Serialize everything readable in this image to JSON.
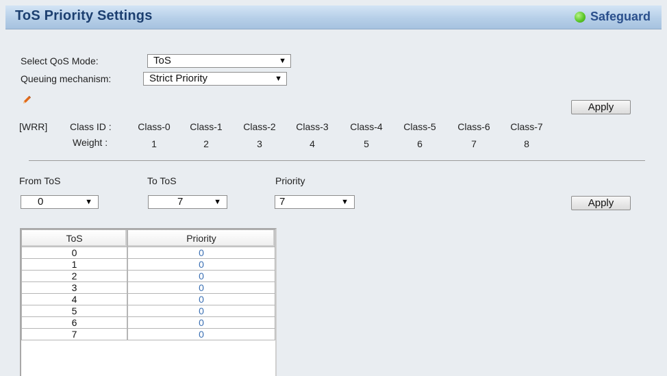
{
  "header": {
    "title": "ToS Priority Settings",
    "safeguard_label": "Safeguard",
    "safeguard_status_color": "#5cc82a"
  },
  "qos": {
    "mode_label": "Select QoS Mode:",
    "mode_value": "ToS",
    "queuing_label": "Queuing mechanism:",
    "queuing_value": "Strict Priority",
    "apply_label": "Apply"
  },
  "wrr": {
    "tag": "[WRR]",
    "class_id_label": "Class ID :",
    "weight_label": "Weight :",
    "classes": [
      "Class-0",
      "Class-1",
      "Class-2",
      "Class-3",
      "Class-4",
      "Class-5",
      "Class-6",
      "Class-7"
    ],
    "weights": [
      "1",
      "2",
      "3",
      "4",
      "5",
      "6",
      "7",
      "8"
    ]
  },
  "range": {
    "from_label": "From ToS",
    "from_value": "0",
    "to_label": "To ToS",
    "to_value": "7",
    "priority_label": "Priority",
    "priority_value": "7",
    "apply_label": "Apply"
  },
  "table": {
    "headers": [
      "ToS",
      "Priority"
    ],
    "rows": [
      {
        "tos": "0",
        "priority": "0"
      },
      {
        "tos": "1",
        "priority": "0"
      },
      {
        "tos": "2",
        "priority": "0"
      },
      {
        "tos": "3",
        "priority": "0"
      },
      {
        "tos": "4",
        "priority": "0"
      },
      {
        "tos": "5",
        "priority": "0"
      },
      {
        "tos": "6",
        "priority": "0"
      },
      {
        "tos": "7",
        "priority": "0"
      }
    ]
  }
}
